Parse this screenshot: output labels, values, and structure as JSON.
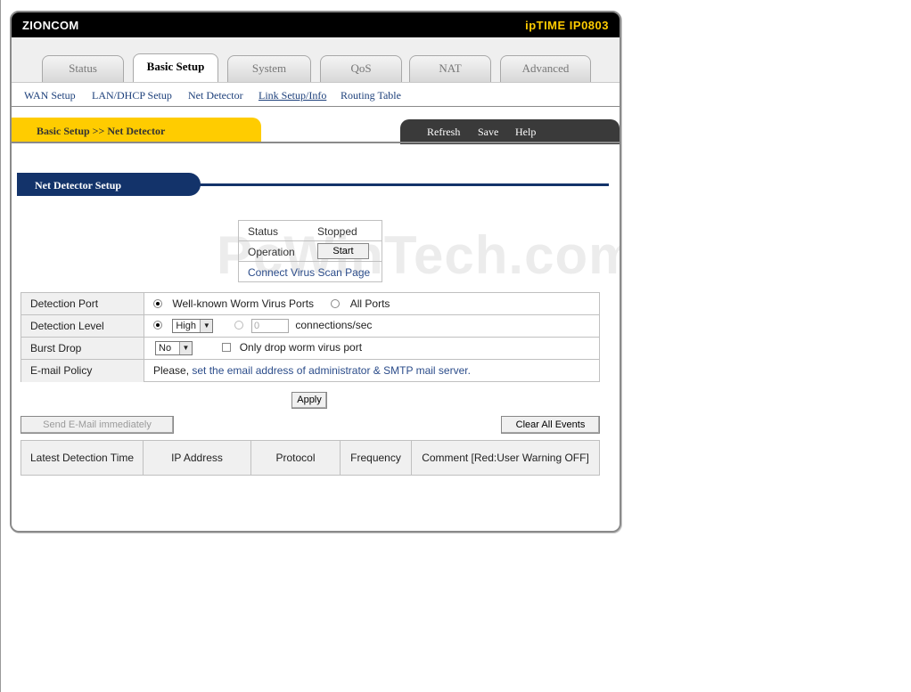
{
  "header": {
    "brand": "ZIONCOM",
    "model": "ipTIME IP0803"
  },
  "tabs": [
    {
      "label": "Status"
    },
    {
      "label": "Basic Setup"
    },
    {
      "label": "System"
    },
    {
      "label": "QoS"
    },
    {
      "label": "NAT"
    },
    {
      "label": "Advanced"
    }
  ],
  "subnav": [
    {
      "label": "WAN Setup"
    },
    {
      "label": "LAN/DHCP Setup"
    },
    {
      "label": "Net Detector"
    },
    {
      "label": "Link Setup/Info"
    },
    {
      "label": "Routing Table"
    }
  ],
  "breadcrumb": "Basic Setup >> Net Detector",
  "actions": {
    "refresh": "Refresh",
    "save": "Save",
    "help": "Help"
  },
  "section_title": "Net Detector Setup",
  "status_box": {
    "status_label": "Status",
    "status_value": "Stopped",
    "operation_label": "Operation",
    "start_button": "Start",
    "scan_link": "Connect Virus Scan Page"
  },
  "settings": {
    "detection_port": {
      "label": "Detection Port",
      "option1": "Well-known Worm Virus Ports",
      "option2": "All Ports"
    },
    "detection_level": {
      "label": "Detection Level",
      "selected": "High",
      "custom_value": "0",
      "unit": "connections/sec"
    },
    "burst_drop": {
      "label": "Burst Drop",
      "selected": "No",
      "checkbox_label": "Only drop worm virus port"
    },
    "email_policy": {
      "label": "E-mail Policy",
      "prefix": "Please,",
      "link": "set the email address of administrator & SMTP mail server."
    }
  },
  "buttons": {
    "apply": "Apply",
    "send_email": "Send E-Mail immediately",
    "clear_events": "Clear All Events"
  },
  "events_table": {
    "columns": [
      "Latest Detection Time",
      "IP Address",
      "Protocol",
      "Frequency",
      "Comment [Red:User Warning OFF]"
    ]
  },
  "watermark": "PcWinTech.com",
  "colors": {
    "header_bg": "#000000",
    "model_text": "#ffcc00",
    "crumb_bg": "#ffcc00",
    "section_bg": "#13336a"
  }
}
